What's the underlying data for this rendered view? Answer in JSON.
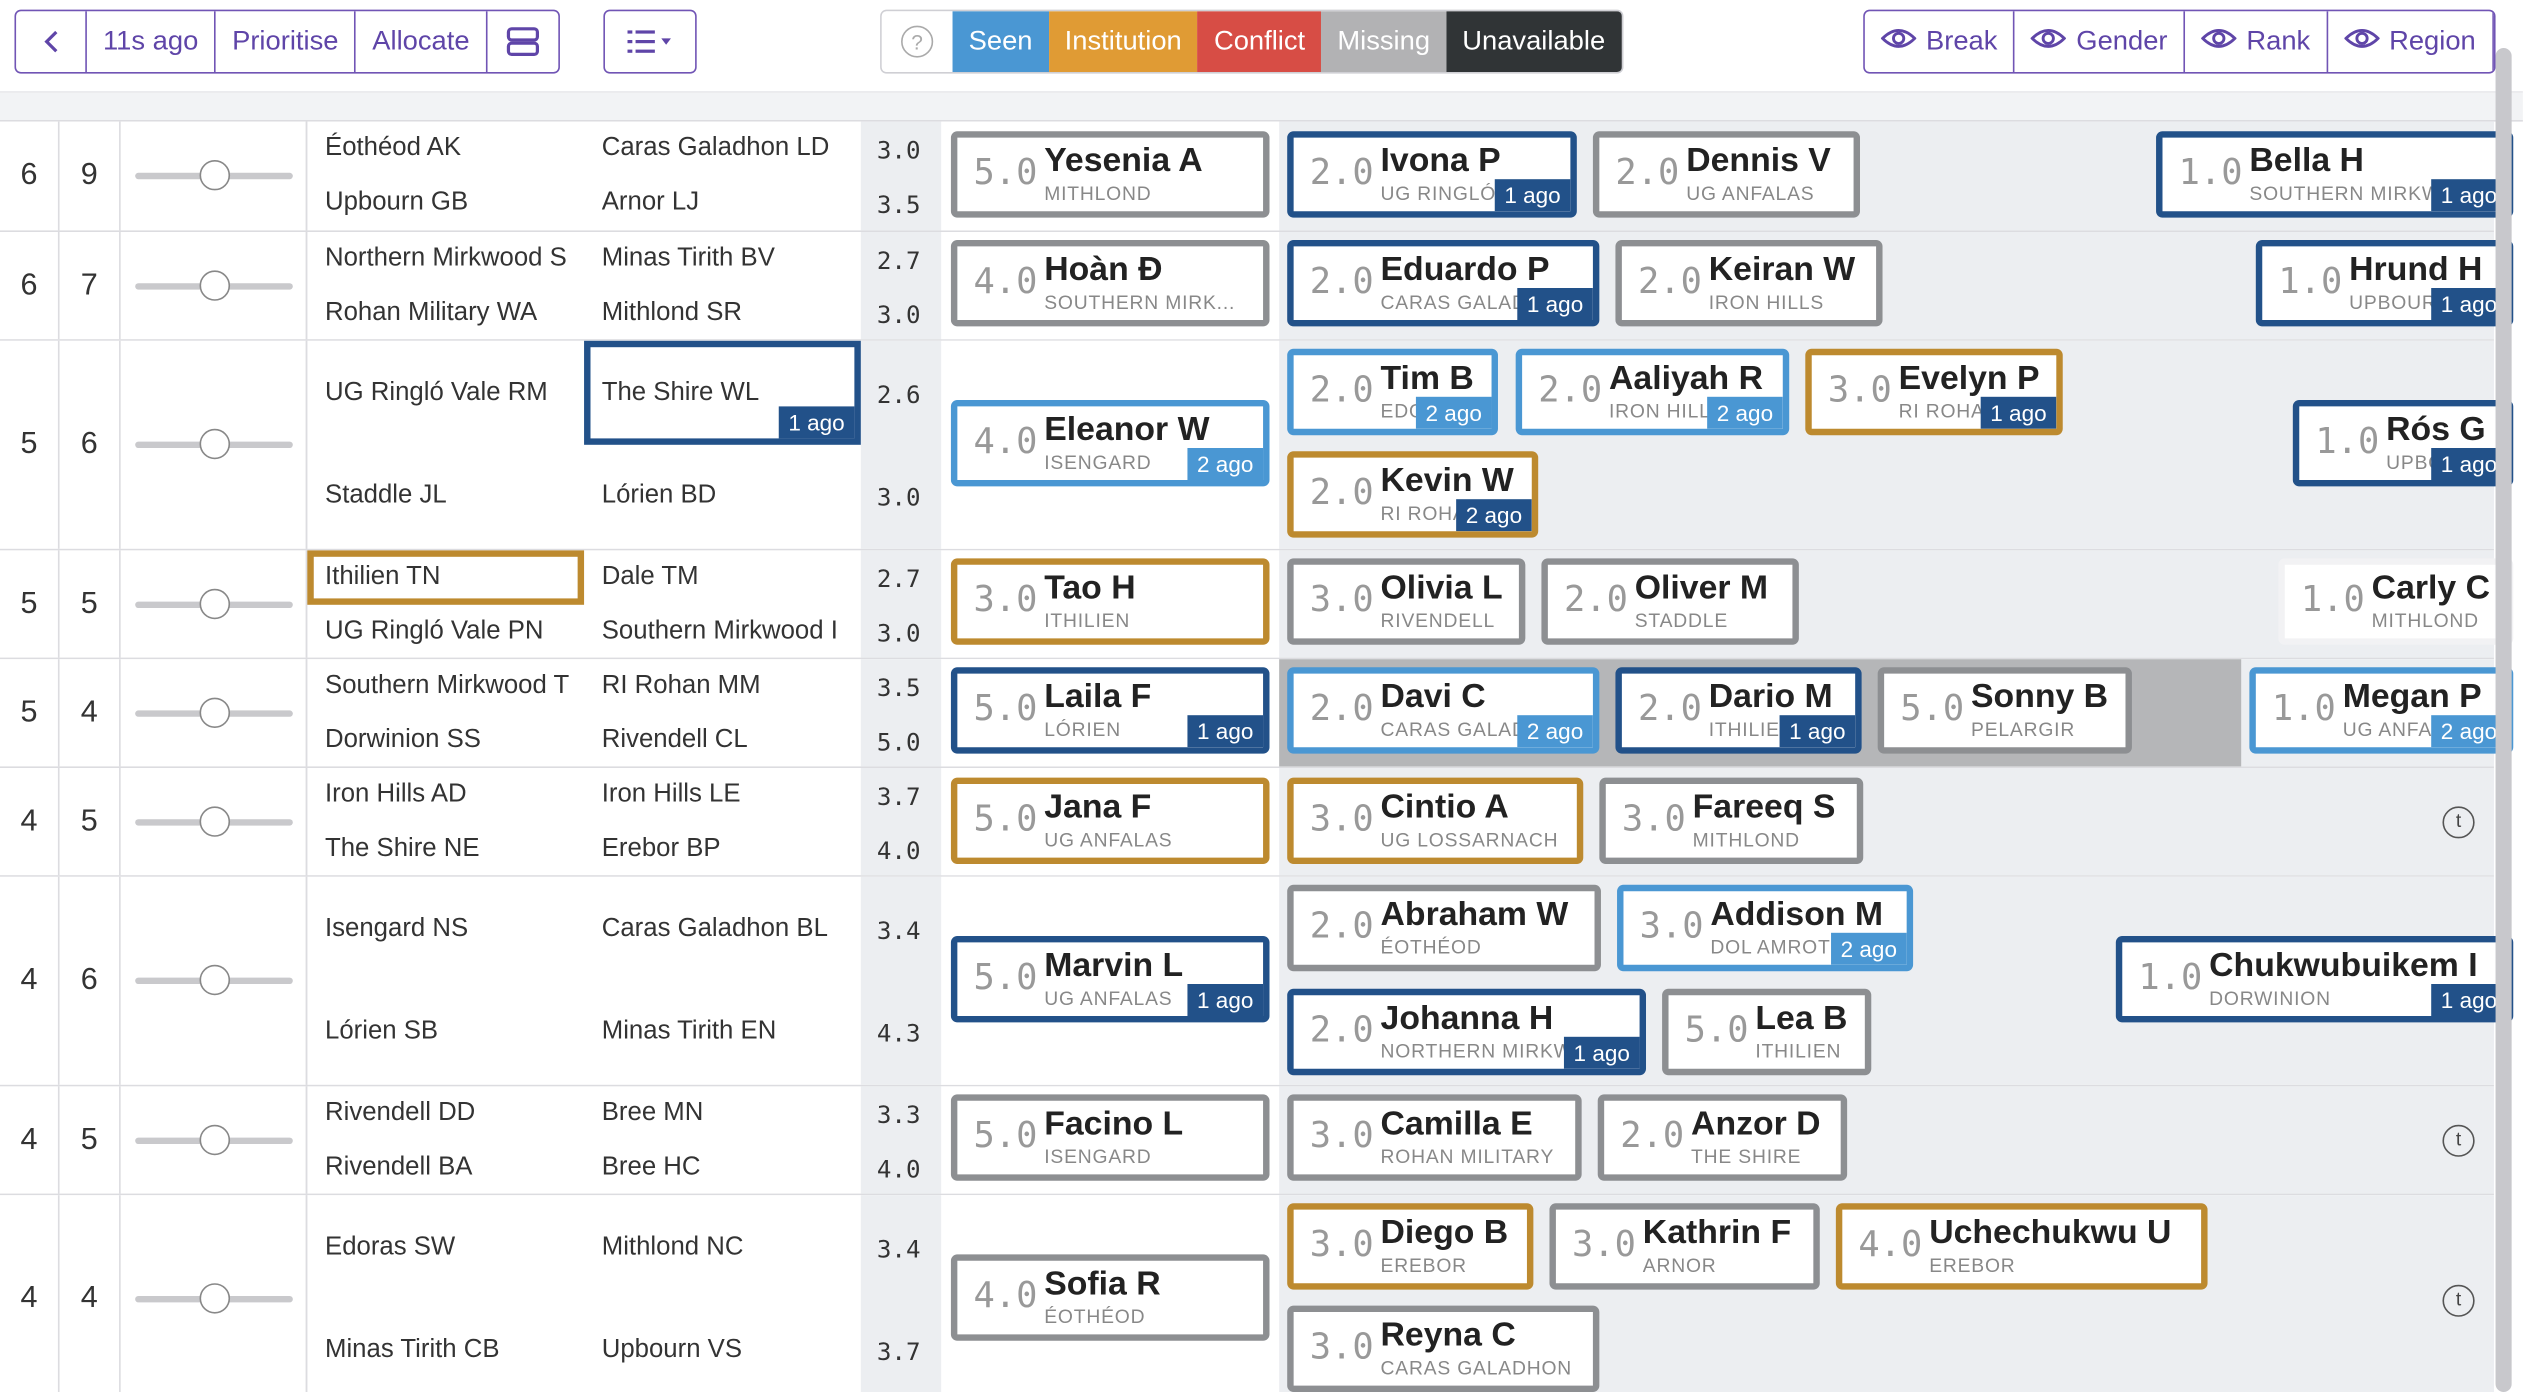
{
  "toolbar": {
    "back_icon": "chevron-left-icon",
    "updated": "11s ago",
    "prioritise": "Prioritise",
    "allocate": "Allocate",
    "layout_icon": "stacked-rows-icon",
    "sort_icon": "list-dropdown-icon",
    "help_icon": "question-icon",
    "keys": [
      {
        "label": "Seen",
        "color": "#4a97d3"
      },
      {
        "label": "Institution",
        "color": "#e09b34"
      },
      {
        "label": "Conflict",
        "color": "#d74d45"
      },
      {
        "label": "Missing",
        "color": "#b2b2b4"
      },
      {
        "label": "Unavailable",
        "color": "#303436"
      }
    ],
    "eye_buttons": [
      "Break",
      "Gender",
      "Rank",
      "Region"
    ]
  },
  "rows": [
    {
      "bracket": "6",
      "live": "9",
      "teams": [
        "Éothéod AK",
        "Caras Galadhon LD",
        "Upbourn GB",
        "Arnor LJ"
      ],
      "speaks": [
        "3.0",
        "3.5"
      ],
      "chair": {
        "score": "5.0",
        "name": "Yesenia A",
        "inst": "MITHLOND"
      },
      "panel": [
        {
          "score": "2.0",
          "name": "Ivona P",
          "inst": "UG RINGLÓ",
          "ago": "1 ago"
        },
        {
          "score": "2.0",
          "name": "Dennis V",
          "inst": "UG ANFALAS"
        }
      ],
      "trainee": {
        "score": "1.0",
        "name": "Bella H",
        "inst": "SOUTHERN MIRKW",
        "ago": "1 ago"
      }
    },
    {
      "bracket": "6",
      "live": "7",
      "teams": [
        "Northern Mirkwood S",
        "Minas Tirith BV",
        "Rohan Military WA",
        "Mithlond SR"
      ],
      "speaks": [
        "2.7",
        "3.0"
      ],
      "chair": {
        "score": "4.0",
        "name": "Hoàn Đ",
        "inst": "SOUTHERN MIRK..."
      },
      "panel": [
        {
          "score": "2.0",
          "name": "Eduardo P",
          "inst": "CARAS GALAD",
          "ago": "1 ago"
        },
        {
          "score": "2.0",
          "name": "Keiran W",
          "inst": "IRON HILLS"
        }
      ],
      "trainee": {
        "score": "1.0",
        "name": "Hrund H",
        "inst": "UPBOUR",
        "ago": "1 ago"
      }
    },
    {
      "bracket": "5",
      "live": "6",
      "teams": [
        "UG Ringló Vale RM",
        "The Shire WL",
        "Staddle JL",
        "Lórien BD"
      ],
      "team_ago": "1 ago",
      "speaks": [
        "2.6",
        "3.0"
      ],
      "chair": {
        "score": "4.0",
        "name": "Eleanor W",
        "inst": "ISENGARD",
        "ago": "2 ago"
      },
      "panel": [
        {
          "score": "2.0",
          "name": "Tim B",
          "inst": "EDO",
          "ago": "2 ago"
        },
        {
          "score": "2.0",
          "name": "Aaliyah R",
          "inst": "IRON HILL",
          "ago": "2 ago"
        },
        {
          "score": "3.0",
          "name": "Evelyn P",
          "inst": "RI ROHA",
          "ago": "1 ago"
        },
        {
          "score": "2.0",
          "name": "Kevin W",
          "inst": "RI ROHA",
          "ago": "2 ago"
        }
      ],
      "trainee": {
        "score": "1.0",
        "name": "Rós G",
        "inst": "UPBO",
        "ago": "1 ago"
      }
    },
    {
      "bracket": "5",
      "live": "5",
      "teams": [
        "Ithilien TN",
        "Dale TM",
        "UG Ringló Vale PN",
        "Southern Mirkwood I"
      ],
      "speaks": [
        "2.7",
        "3.0"
      ],
      "chair": {
        "score": "3.0",
        "name": "Tao H",
        "inst": "ITHILIEN"
      },
      "panel": [
        {
          "score": "3.0",
          "name": "Olivia L",
          "inst": "RIVENDELL"
        },
        {
          "score": "2.0",
          "name": "Oliver M",
          "inst": "STADDLE"
        }
      ],
      "trainee": {
        "score": "1.0",
        "name": "Carly C",
        "inst": "MITHLOND"
      }
    },
    {
      "bracket": "5",
      "live": "4",
      "teams": [
        "Southern Mirkwood T",
        "RI Rohan MM",
        "Dorwinion SS",
        "Rivendell CL"
      ],
      "speaks": [
        "3.5",
        "5.0"
      ],
      "chair": {
        "score": "5.0",
        "name": "Laila F",
        "inst": "LÓRIEN",
        "ago": "1 ago"
      },
      "panel": [
        {
          "score": "2.0",
          "name": "Davi C",
          "inst": "CARAS GALAD",
          "ago": "2 ago"
        },
        {
          "score": "2.0",
          "name": "Dario M",
          "inst": "ITHILIE",
          "ago": "1 ago"
        },
        {
          "score": "5.0",
          "name": "Sonny B",
          "inst": "PELARGIR"
        }
      ],
      "trainee": {
        "score": "1.0",
        "name": "Megan P",
        "inst": "UG ANFA",
        "ago": "2 ago"
      }
    },
    {
      "bracket": "4",
      "live": "5",
      "teams": [
        "Iron Hills AD",
        "Iron Hills LE",
        "The Shire NE",
        "Erebor BP"
      ],
      "speaks": [
        "3.7",
        "4.0"
      ],
      "chair": {
        "score": "5.0",
        "name": "Jana F",
        "inst": "UG ANFALAS"
      },
      "panel": [
        {
          "score": "3.0",
          "name": "Cintio A",
          "inst": "UG LOSSARNACH"
        },
        {
          "score": "3.0",
          "name": "Fareeq S",
          "inst": "MITHLOND"
        }
      ],
      "trainee_icon": "t"
    },
    {
      "bracket": "4",
      "live": "6",
      "teams": [
        "Isengard NS",
        "Caras Galadhon BL",
        "Lórien SB",
        "Minas Tirith EN"
      ],
      "speaks": [
        "3.4",
        "4.3"
      ],
      "chair": {
        "score": "5.0",
        "name": "Marvin L",
        "inst": "UG ANFALAS",
        "ago": "1 ago"
      },
      "panel": [
        {
          "score": "2.0",
          "name": "Abraham W",
          "inst": "ÉOTHÉOD"
        },
        {
          "score": "3.0",
          "name": "Addison M",
          "inst": "DOL AMROT",
          "ago": "2 ago"
        },
        {
          "score": "2.0",
          "name": "Johanna H",
          "inst": "NORTHERN MIRKW",
          "ago": "1 ago"
        },
        {
          "score": "5.0",
          "name": "Lea B",
          "inst": "ITHILIEN"
        }
      ],
      "trainee": {
        "score": "1.0",
        "name": "Chukwubuikem I",
        "inst": "DORWINION",
        "ago": "1 ago"
      }
    },
    {
      "bracket": "4",
      "live": "5",
      "teams": [
        "Rivendell DD",
        "Bree MN",
        "Rivendell BA",
        "Bree HC"
      ],
      "speaks": [
        "3.3",
        "4.0"
      ],
      "chair": {
        "score": "5.0",
        "name": "Facino L",
        "inst": "ISENGARD"
      },
      "panel": [
        {
          "score": "3.0",
          "name": "Camilla E",
          "inst": "ROHAN MILITARY"
        },
        {
          "score": "2.0",
          "name": "Anzor D",
          "inst": "THE SHIRE"
        }
      ],
      "trainee_icon": "t"
    },
    {
      "bracket": "4",
      "live": "4",
      "teams": [
        "Edoras SW",
        "Mithlond NC",
        "Minas Tirith CB",
        "Upbourn VS"
      ],
      "speaks": [
        "3.4",
        "3.7"
      ],
      "chair": {
        "score": "4.0",
        "name": "Sofia R",
        "inst": "ÉOTHÉOD"
      },
      "panel": [
        {
          "score": "3.0",
          "name": "Diego B",
          "inst": "EREBOR"
        },
        {
          "score": "3.0",
          "name": "Kathrin F",
          "inst": "ARNOR"
        },
        {
          "score": "4.0",
          "name": "Uchechukwu U",
          "inst": "EREBOR"
        },
        {
          "score": "3.0",
          "name": "Reyna C",
          "inst": "CARAS GALADHON"
        }
      ],
      "trainee_icon": "t"
    }
  ]
}
